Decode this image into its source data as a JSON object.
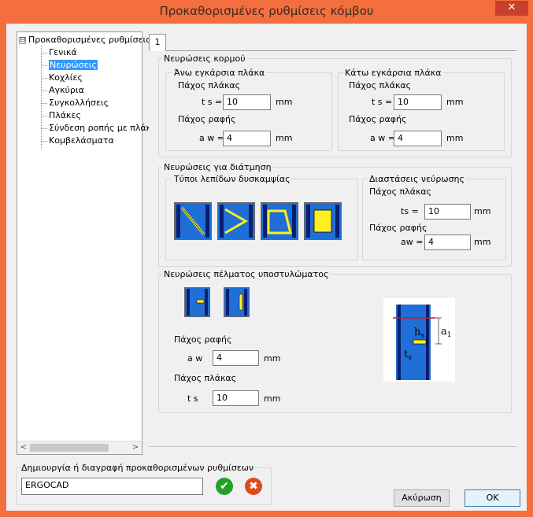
{
  "window": {
    "title": "Προκαθορισμένες ρυθμίσεις κόμβου",
    "close_glyph": "✕"
  },
  "tree": {
    "root": "Προκαθορισμένες ρυθμίσεις",
    "expander": "⊟",
    "items": [
      "Γενικά",
      "Νευρώσεις",
      "Κοχλίες",
      "Αγκύρια",
      "Συγκολλήσεις",
      "Πλάκες",
      "Σύνδεση ροπής με πλάκι",
      "Κομβελάσματα"
    ],
    "selected_index": 1
  },
  "tab": {
    "label": "1"
  },
  "web_ribs": {
    "title": "Νευρώσεις κορμού",
    "upper": {
      "title": "Άνω εγκάρσια πλάκα",
      "plate_thk": "Πάχος πλάκας",
      "ts_label": "t s =",
      "ts": "10",
      "unit": "mm",
      "weld_thk": "Πάχος ραφής",
      "aw_label": "a w =",
      "aw": "4",
      "unit2": "mm"
    },
    "lower": {
      "title": "Κάτω εγκάρσια πλάκα",
      "plate_thk": "Πάχος πλάκας",
      "ts_label": "t s =",
      "ts": "10",
      "unit": "mm",
      "weld_thk": "Πάχος ραφής",
      "aw_label": "a w =",
      "aw": "4",
      "unit2": "mm"
    }
  },
  "shear_ribs": {
    "title": "Νευρώσεις για διάτμηση",
    "types_title": "Τύποι λεπίδων δυσκαμψίας",
    "dims": {
      "title": "Διαστάσεις νεύρωσης",
      "plate_thk": "Πάχος πλάκας",
      "ts_label": "ts =",
      "ts": "10",
      "unit": "mm",
      "weld_thk": "Πάχος ραφής",
      "aw_label": "aw =",
      "aw": "4",
      "unit2": "mm"
    }
  },
  "base_ribs": {
    "title": "Νευρώσεις πέλματος υποστυλώματος",
    "weld_thk": "Πάχος ραφής",
    "aw_label": "a w",
    "aw": "4",
    "unit": "mm",
    "plate_thk": "Πάχος πλάκας",
    "ts_label": "t s",
    "ts": "10",
    "unit2": "mm",
    "diagram": {
      "hs": "h",
      "hs_sub": "s",
      "a1": "a",
      "a1_sub": "1",
      "ts": "t",
      "ts_sub": "s"
    }
  },
  "preset": {
    "title": "Δημιουργία ή διαγραφή προκαθορισμένων ρυθμίσεων",
    "value": "ERGOCAD",
    "ok_glyph": "✔",
    "del_glyph": "✖"
  },
  "buttons": {
    "cancel": "Ακύρωση",
    "ok": "OK"
  },
  "colors": {
    "titlebar": "#f36f3d",
    "accent_blue": "#1f6fd6",
    "steel_yellow": "#ffee22"
  }
}
